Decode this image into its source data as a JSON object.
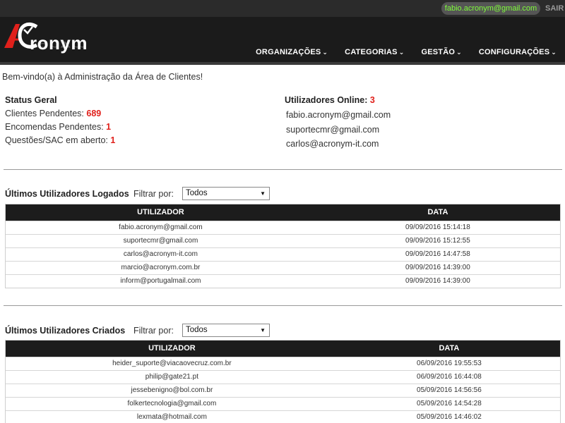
{
  "topbar": {
    "user_email": "fabio.acronym@gmail.com",
    "logout_label": "SAIR"
  },
  "brand": {
    "logo_text": "ronym",
    "logo_mark": "AC",
    "colors": {
      "accent": "#e0201b",
      "header_bg": "#1b1b1b",
      "email_green": "#7fff3a"
    }
  },
  "nav": {
    "items": [
      {
        "label": "ORGANIZAÇÕES",
        "icon": "chevron-down-icon"
      },
      {
        "label": "CATEGORIAS",
        "icon": "chevron-down-icon"
      },
      {
        "label": "GESTÃO",
        "icon": "chevron-down-icon"
      },
      {
        "label": "CONFIGURAÇÕES",
        "icon": "chevron-down-icon"
      }
    ]
  },
  "welcome": "Bem-vindo(a) à Administração da Área de Clientes!",
  "status": {
    "title": "Status Geral",
    "items": [
      {
        "label": "Clientes Pendentes:",
        "value": "689"
      },
      {
        "label": "Encomendas Pendentes:",
        "value": "1"
      },
      {
        "label": "Questões/SAC em aberto:",
        "value": "1"
      }
    ]
  },
  "online": {
    "title": "Utilizadores Online:",
    "count": "3",
    "users": [
      "fabio.acronym@gmail.com",
      "suportecmr@gmail.com",
      "carlos@acronym-it.com"
    ]
  },
  "logged": {
    "title": "Últimos Utilizadores Logados",
    "filter_label": "Filtrar por:",
    "filter_value": "Todos",
    "columns": [
      "UTILIZADOR",
      "DATA"
    ],
    "rows": [
      [
        "fabio.acronym@gmail.com",
        "09/09/2016 15:14:18"
      ],
      [
        "suportecmr@gmail.com",
        "09/09/2016 15:12:55"
      ],
      [
        "carlos@acronym-it.com",
        "09/09/2016 14:47:58"
      ],
      [
        "marcio@acronym.com.br",
        "09/09/2016 14:39:00"
      ],
      [
        "inform@portugalmail.com",
        "09/09/2016 14:39:00"
      ]
    ]
  },
  "created": {
    "title": "Últimos Utilizadores Criados",
    "filter_label": "Filtrar por:",
    "filter_value": "Todos",
    "columns": [
      "UTILIZADOR",
      "DATA"
    ],
    "rows": [
      [
        "heider_suporte@viacaovecruz.com.br",
        "06/09/2016 19:55:53"
      ],
      [
        "philip@gate21.pt",
        "06/09/2016 16:44:08"
      ],
      [
        "jessebenigno@bol.com.br",
        "05/09/2016 14:56:56"
      ],
      [
        "folkertecnologia@gmail.com",
        "05/09/2016 14:54:28"
      ],
      [
        "lexmata@hotmail.com",
        "05/09/2016 14:46:02"
      ]
    ]
  }
}
